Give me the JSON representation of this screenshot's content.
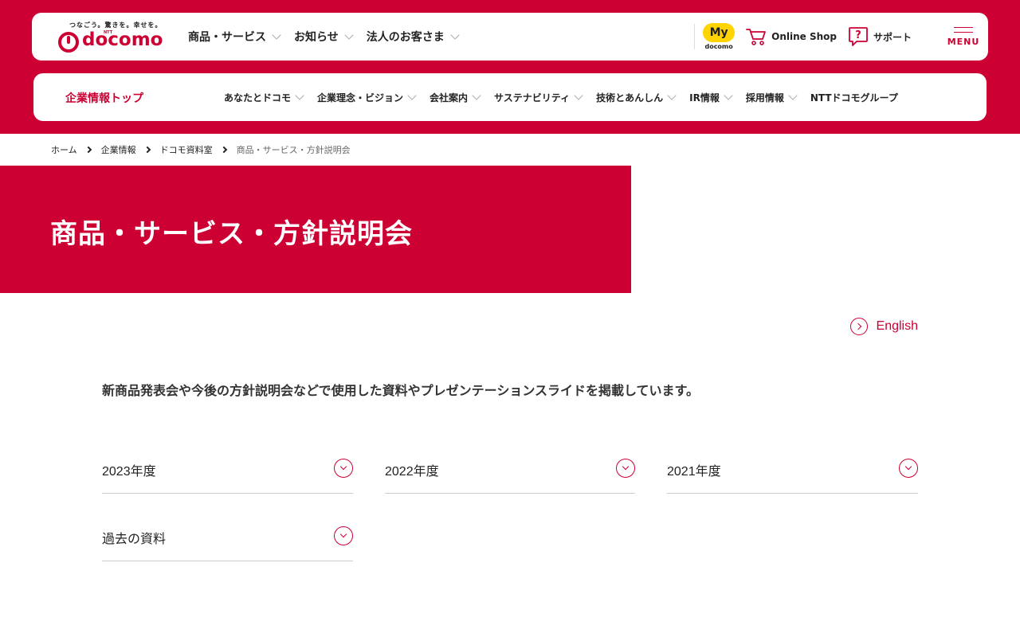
{
  "header": {
    "logo": {
      "tagline": "つなごう。驚きを。幸せを。",
      "ntt": "NTT",
      "wordmark": "docomo"
    },
    "nav": [
      {
        "label": "商品・サービス"
      },
      {
        "label": "お知らせ"
      },
      {
        "label": "法人のお客さま"
      }
    ],
    "my_docomo": {
      "badge": "My",
      "sub": "docomo"
    },
    "online_shop": "Online Shop",
    "support": "サポート",
    "menu": "MENU"
  },
  "corp_nav": {
    "top": "企業情報トップ",
    "items": [
      {
        "label": "あなたとドコモ",
        "dropdown": true
      },
      {
        "label": "企業理念・ビジョン",
        "dropdown": true
      },
      {
        "label": "会社案内",
        "dropdown": true
      },
      {
        "label": "サステナビリティ",
        "dropdown": true
      },
      {
        "label": "技術とあんしん",
        "dropdown": true
      },
      {
        "label": "IR情報",
        "dropdown": true
      },
      {
        "label": "採用情報",
        "dropdown": true
      },
      {
        "label": "NTTドコモグループ",
        "dropdown": false
      }
    ]
  },
  "breadcrumb": [
    "ホーム",
    "企業情報",
    "ドコモ資料室",
    "商品・サービス・方針説明会"
  ],
  "hero": {
    "title": "商品・サービス・方針説明会"
  },
  "english_link": "English",
  "intro": "新商品発表会や今後の方針説明会などで使用した資料やプレゼンテーションスライドを掲載しています。",
  "accordions": [
    {
      "label": "2023年度"
    },
    {
      "label": "2022年度"
    },
    {
      "label": "2021年度"
    },
    {
      "label": "過去の資料"
    }
  ],
  "colors": {
    "brand_red": "#cc0033",
    "my_docomo_yellow": "#ffd400"
  },
  "icons": [
    "cart-icon",
    "support-question-icon",
    "menu-icon",
    "chevron-down-icon",
    "chevron-right-icon",
    "circle-arrow-icon"
  ]
}
